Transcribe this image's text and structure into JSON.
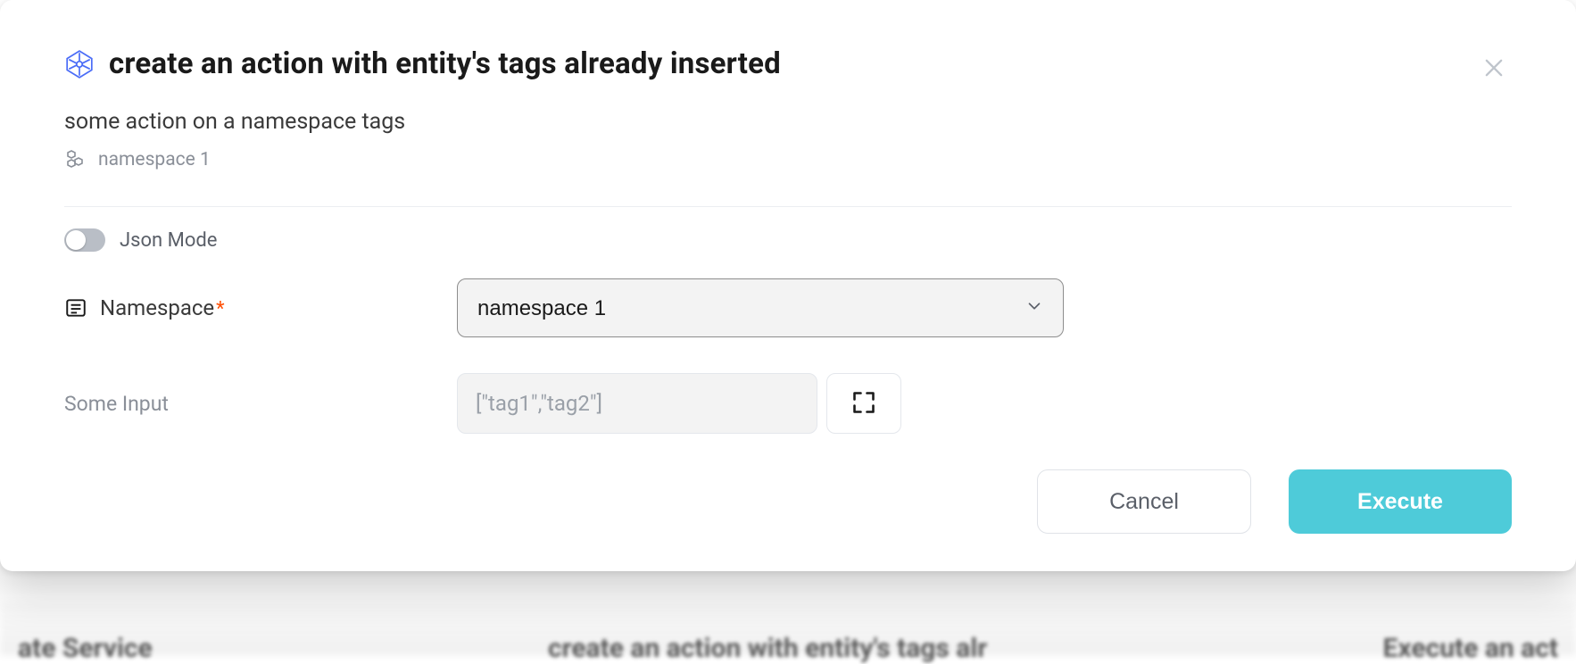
{
  "header": {
    "title": "create an action with entity's tags already inserted",
    "subtitle": "some action on a namespace tags",
    "entity": "namespace 1"
  },
  "form": {
    "jsonMode": {
      "label": "Json Mode",
      "on": false
    },
    "namespace": {
      "label": "Namespace",
      "required": true,
      "value": "namespace 1"
    },
    "someInput": {
      "label": "Some Input",
      "placeholder": "[\"tag1\",\"tag2\"]",
      "value": ""
    }
  },
  "footer": {
    "cancel": "Cancel",
    "execute": "Execute"
  },
  "background": {
    "left": "ate Service",
    "mid": "create an action with entity's tags alr",
    "right": "Execute an act"
  }
}
